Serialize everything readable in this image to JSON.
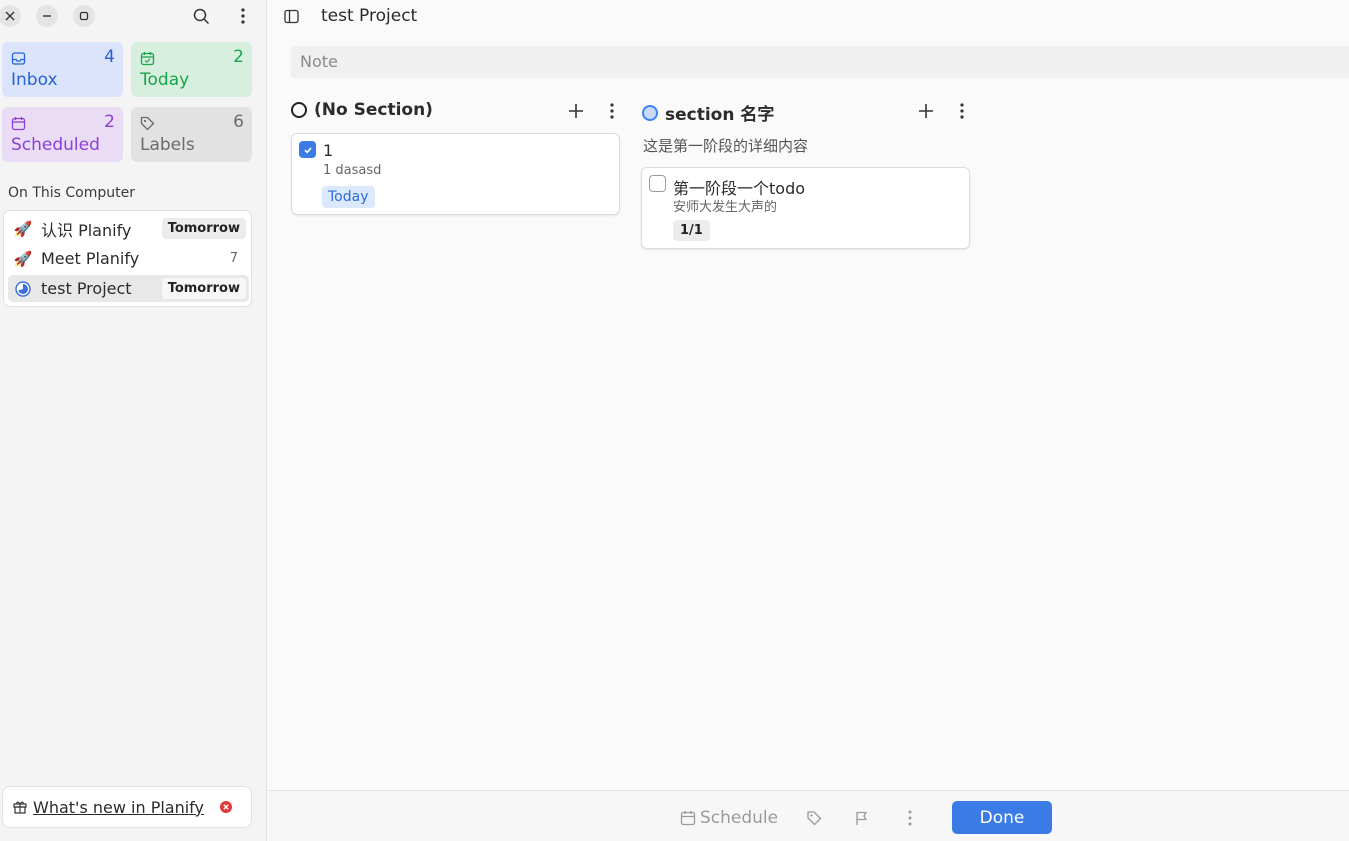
{
  "sidebar": {
    "tiles": {
      "inbox": {
        "label": "Inbox",
        "count": "4",
        "color": "#2563d6",
        "bg": "#dbe4fa"
      },
      "today": {
        "label": "Today",
        "count": "2",
        "color": "#1aa34a",
        "bg": "#d7efdf"
      },
      "scheduled": {
        "label": "Scheduled",
        "count": "2",
        "color": "#8b3fd6",
        "bg": "#eadcf5"
      },
      "labels": {
        "label": "Labels",
        "count": "6",
        "color": "#6b6b6b",
        "bg": "#e2e2e2"
      }
    },
    "section_title": "On This Computer",
    "projects": [
      {
        "icon": "🚀",
        "name": "认识 Planify",
        "badge": "Tomorrow"
      },
      {
        "icon": "🚀",
        "name": "Meet Planify",
        "count": "7"
      },
      {
        "icon": "progress-circle-icon",
        "name": "test Project",
        "badge": "Tomorrow"
      }
    ],
    "whats_new": "What's new in Planify"
  },
  "main": {
    "title": "test Project",
    "note_placeholder": "Note",
    "columns": [
      {
        "name": "(No Section)",
        "cards": [
          {
            "title": "1",
            "desc": "1 dasasd",
            "tag": "Today",
            "checked": true
          }
        ]
      },
      {
        "name": "section 名字",
        "description": "这是第一阶段的详细内容",
        "cards": [
          {
            "title": "第一阶段一个todo",
            "desc": "安师大发生大声的",
            "subtasks": "1/1",
            "checked": false
          }
        ]
      }
    ]
  },
  "bottombar": {
    "schedule": "Schedule",
    "done": "Done"
  },
  "colors": {
    "accent": "#3b7be6"
  }
}
